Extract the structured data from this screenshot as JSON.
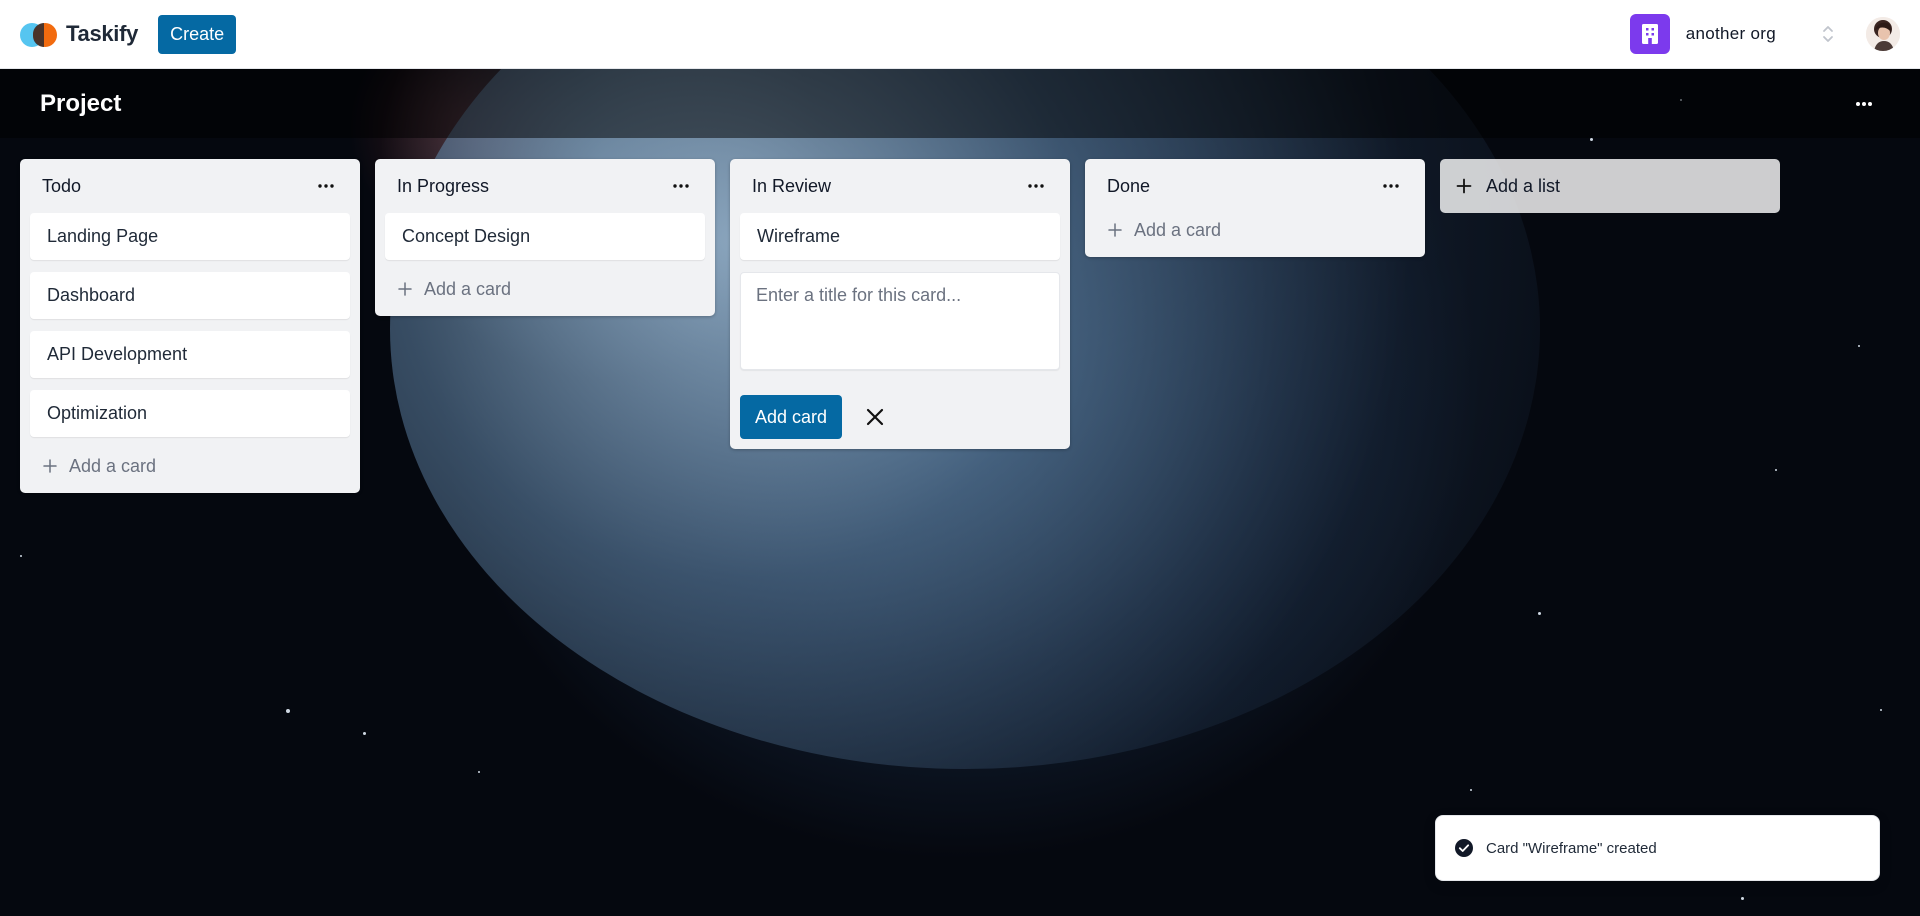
{
  "app": {
    "name": "Taskify",
    "create_label": "Create"
  },
  "org": {
    "name": "another org",
    "icon": "building-icon",
    "color": "#7c3aed"
  },
  "board": {
    "title": "Project"
  },
  "lists": [
    {
      "title": "Todo",
      "cards": [
        "Landing Page",
        "Dashboard",
        "API Development",
        "Optimization"
      ],
      "add_label": "Add a card"
    },
    {
      "title": "In Progress",
      "cards": [
        "Concept Design"
      ],
      "add_label": "Add a card"
    },
    {
      "title": "In Review",
      "cards": [
        "Wireframe"
      ],
      "form": {
        "placeholder": "Enter a title for this card...",
        "value": "",
        "submit_label": "Add card"
      }
    },
    {
      "title": "Done",
      "cards": [],
      "add_label": "Add a card"
    }
  ],
  "add_list_label": "Add a list",
  "toast": {
    "message": "Card \"Wireframe\" created",
    "icon": "check-circle-icon"
  },
  "colors": {
    "primary": "#0569a3",
    "list_bg": "#f1f2f4"
  }
}
